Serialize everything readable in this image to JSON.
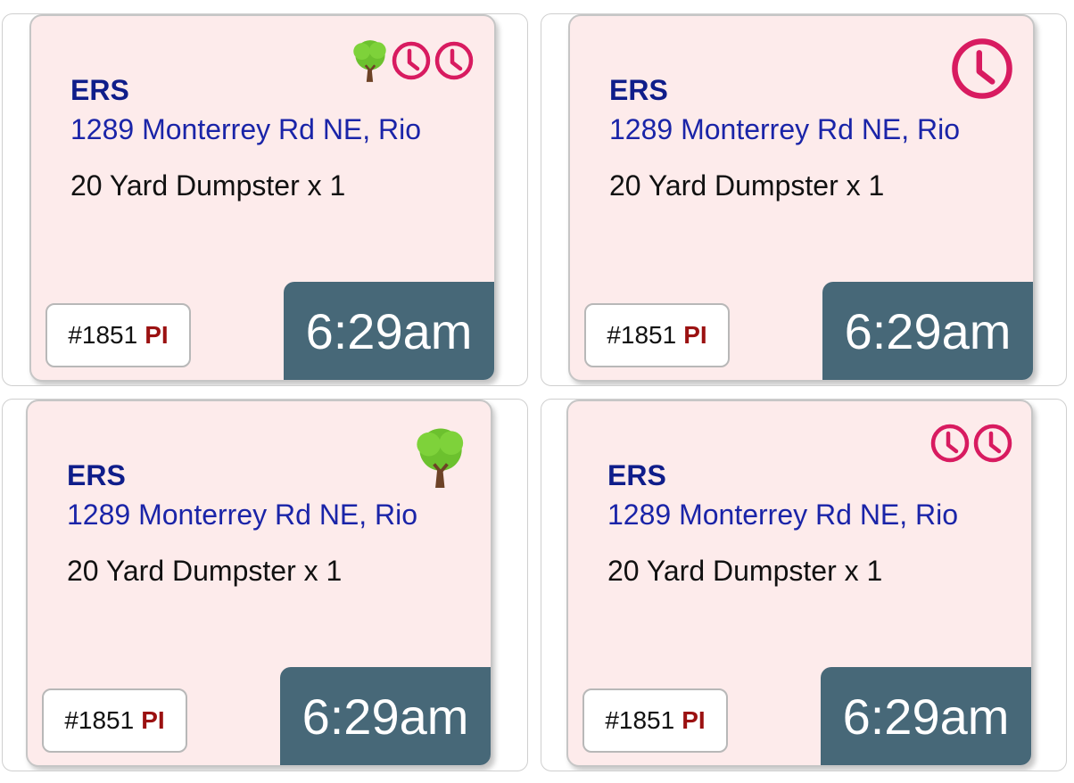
{
  "cards": [
    {
      "company": "ERS",
      "address": "1289 Monterrey Rd NE, Rio",
      "item": "20 Yard Dumpster x 1",
      "order_number": "#1851",
      "flag": "PI",
      "time": "6:29am",
      "icons": [
        "tree-icon",
        "clock-icon",
        "clock-icon"
      ]
    },
    {
      "company": "ERS",
      "address": "1289 Monterrey Rd NE, Rio",
      "item": "20 Yard Dumpster x 1",
      "order_number": "#1851",
      "flag": "PI",
      "time": "6:29am",
      "icons": [
        "clock-icon"
      ]
    },
    {
      "company": "ERS",
      "address": "1289 Monterrey Rd NE, Rio",
      "item": "20 Yard Dumpster x 1",
      "order_number": "#1851",
      "flag": "PI",
      "time": "6:29am",
      "icons": [
        "tree-icon"
      ]
    },
    {
      "company": "ERS",
      "address": "1289 Monterrey Rd NE, Rio",
      "item": "20 Yard Dumpster x 1",
      "order_number": "#1851",
      "flag": "PI",
      "time": "6:29am",
      "icons": [
        "clock-icon",
        "clock-icon"
      ]
    }
  ],
  "colors": {
    "card_background": "#fdebeb",
    "company": "#0f1d8a",
    "address": "#1a24a8",
    "time_block": "#476878",
    "flag": "#9b1111",
    "clock_icon": "#d81b60"
  }
}
